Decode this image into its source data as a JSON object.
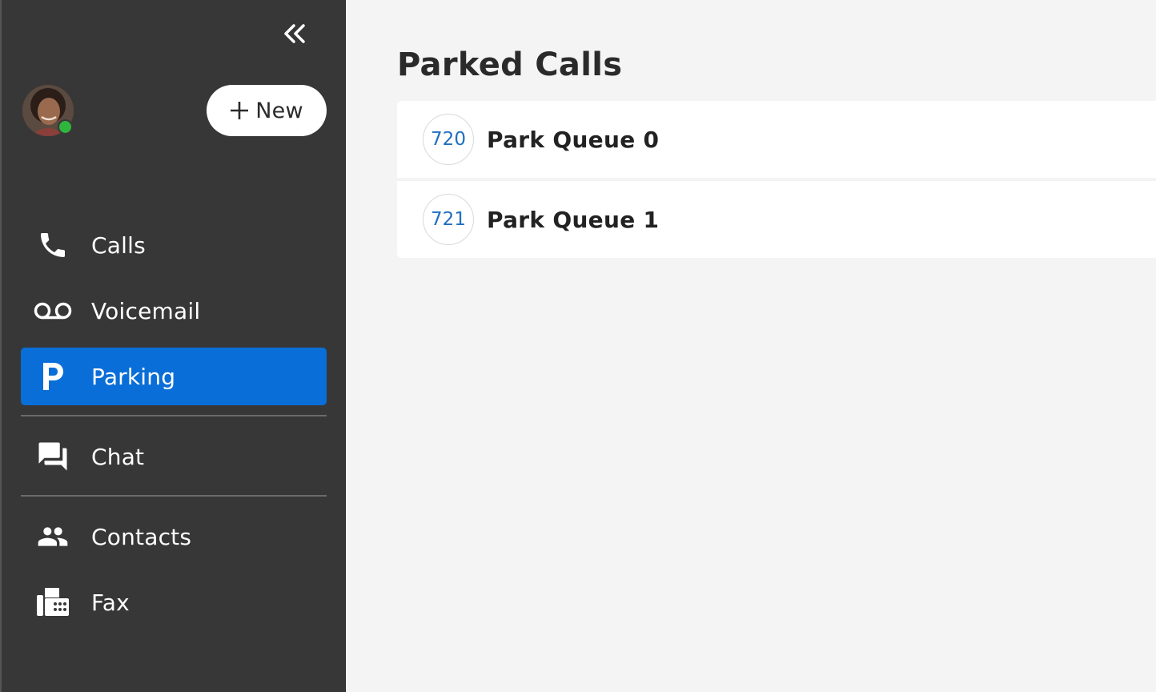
{
  "sidebar": {
    "collapse_icon": "double-chevron-left-icon",
    "user": {
      "presence": "online",
      "presence_color": "#2fb53d"
    },
    "new_button": {
      "icon": "plus-icon",
      "label": "New"
    },
    "items": [
      {
        "id": "calls",
        "label": "Calls",
        "icon": "phone-icon",
        "active": false
      },
      {
        "id": "voicemail",
        "label": "Voicemail",
        "icon": "voicemail-icon",
        "active": false
      },
      {
        "id": "parking",
        "label": "Parking",
        "icon": "parking-icon",
        "active": true
      },
      {
        "id": "chat",
        "label": "Chat",
        "icon": "chat-icon",
        "active": false
      },
      {
        "id": "contacts",
        "label": "Contacts",
        "icon": "contacts-icon",
        "active": false
      },
      {
        "id": "fax",
        "label": "Fax",
        "icon": "fax-icon",
        "active": false
      }
    ],
    "accent_color": "#0a6ed8"
  },
  "main": {
    "title": "Parked Calls",
    "queues": [
      {
        "extension": "720",
        "name": "Park Queue 0"
      },
      {
        "extension": "721",
        "name": "Park Queue 1"
      }
    ]
  }
}
